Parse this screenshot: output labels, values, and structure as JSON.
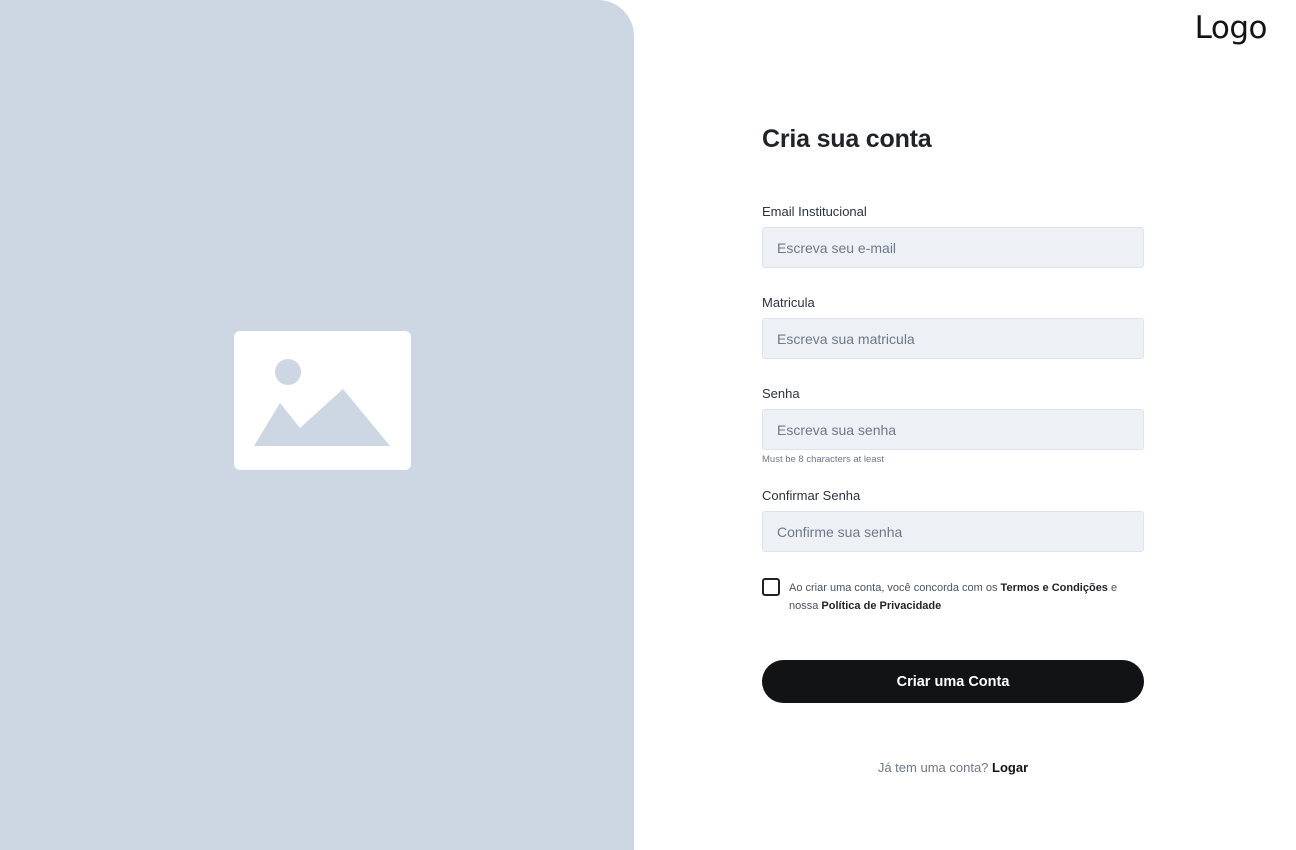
{
  "logo": "Logo",
  "form": {
    "title": "Cria sua conta",
    "fields": [
      {
        "label": "Email Institucional",
        "placeholder": "Escreva seu e-mail",
        "hint": ""
      },
      {
        "label": "Matricula",
        "placeholder": "Escreva sua matricula",
        "hint": ""
      },
      {
        "label": "Senha",
        "placeholder": "Escreva sua senha",
        "hint": "Must be 8 characters at least"
      },
      {
        "label": "Confirmar Senha",
        "placeholder": "Confirme sua senha",
        "hint": ""
      }
    ],
    "terms": {
      "prefix": "Ao criar uma conta, você concorda com os ",
      "terms_link": "Termos e Condições",
      "middle": " e nossa ",
      "privacy_link": "Política de Privacidade"
    },
    "submit_label": "Criar uma Conta",
    "login_prompt": "Já tem uma conta?",
    "login_link": "Logar"
  },
  "icons": {
    "hero": "image-placeholder-icon"
  },
  "colors": {
    "panel": "#cdd7e3",
    "input_bg": "#edf1f5",
    "button": "#121315"
  }
}
